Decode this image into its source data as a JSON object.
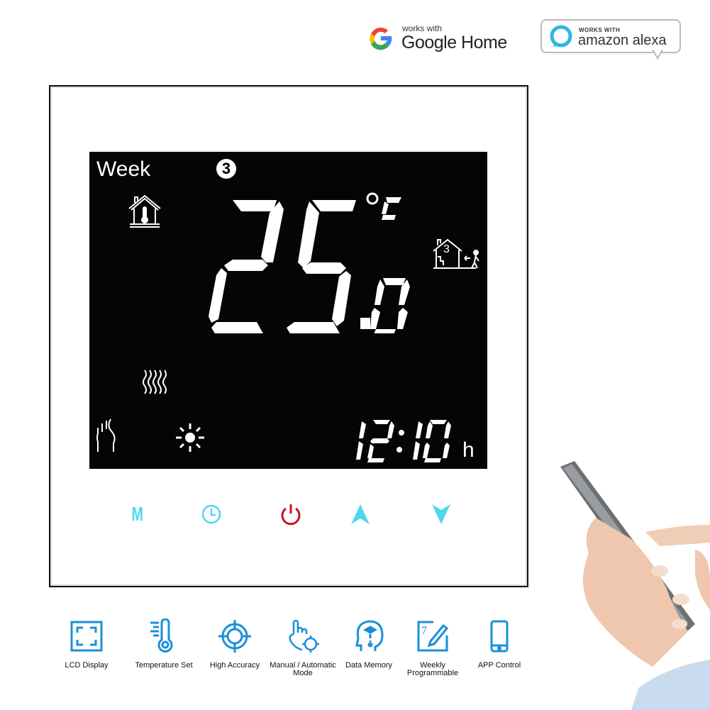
{
  "badges": {
    "google": {
      "prefix": "works with",
      "name": "Google Home"
    },
    "alexa": {
      "prefix": "WORKS WITH",
      "name": "amazon alexa"
    }
  },
  "lcd": {
    "mode_label": "Week",
    "program_number": "3",
    "temperature": {
      "integer": "25",
      "decimal": "0",
      "unit": "°C"
    },
    "away_house_number": "3",
    "time": {
      "value": "12:10",
      "unit": "h"
    },
    "icons": [
      "house-thermometer-icon",
      "away-mode-icon",
      "heating-waves-icon",
      "hand-heat-icon",
      "sun-icon"
    ]
  },
  "touch_buttons": [
    {
      "name": "mode",
      "label": "M",
      "color": "#4fd6f0"
    },
    {
      "name": "clock",
      "label": "",
      "color": "#4fd6f0"
    },
    {
      "name": "power",
      "label": "",
      "color": "#c8141a"
    },
    {
      "name": "up",
      "label": "",
      "color": "#4fd6f0"
    },
    {
      "name": "down",
      "label": "",
      "color": "#4fd6f0"
    }
  ],
  "features": [
    {
      "icon": "lcd-display-icon",
      "label": "LCD Display"
    },
    {
      "icon": "temperature-set-icon",
      "label": "Temperature Set"
    },
    {
      "icon": "high-accuracy-icon",
      "label": "High Accuracy"
    },
    {
      "icon": "manual-automatic-icon",
      "label": "Manual / Automatic Mode"
    },
    {
      "icon": "data-memory-icon",
      "label": "Data Memory"
    },
    {
      "icon": "weekly-programmable-icon",
      "label": "Weekly Programmable"
    },
    {
      "icon": "app-control-icon",
      "label": "APP Control"
    }
  ],
  "colors": {
    "accent_blue": "#1a8fd8",
    "lcd_bg": "#050505",
    "power_red": "#c8141a",
    "touch_cyan": "#4fd6f0"
  }
}
